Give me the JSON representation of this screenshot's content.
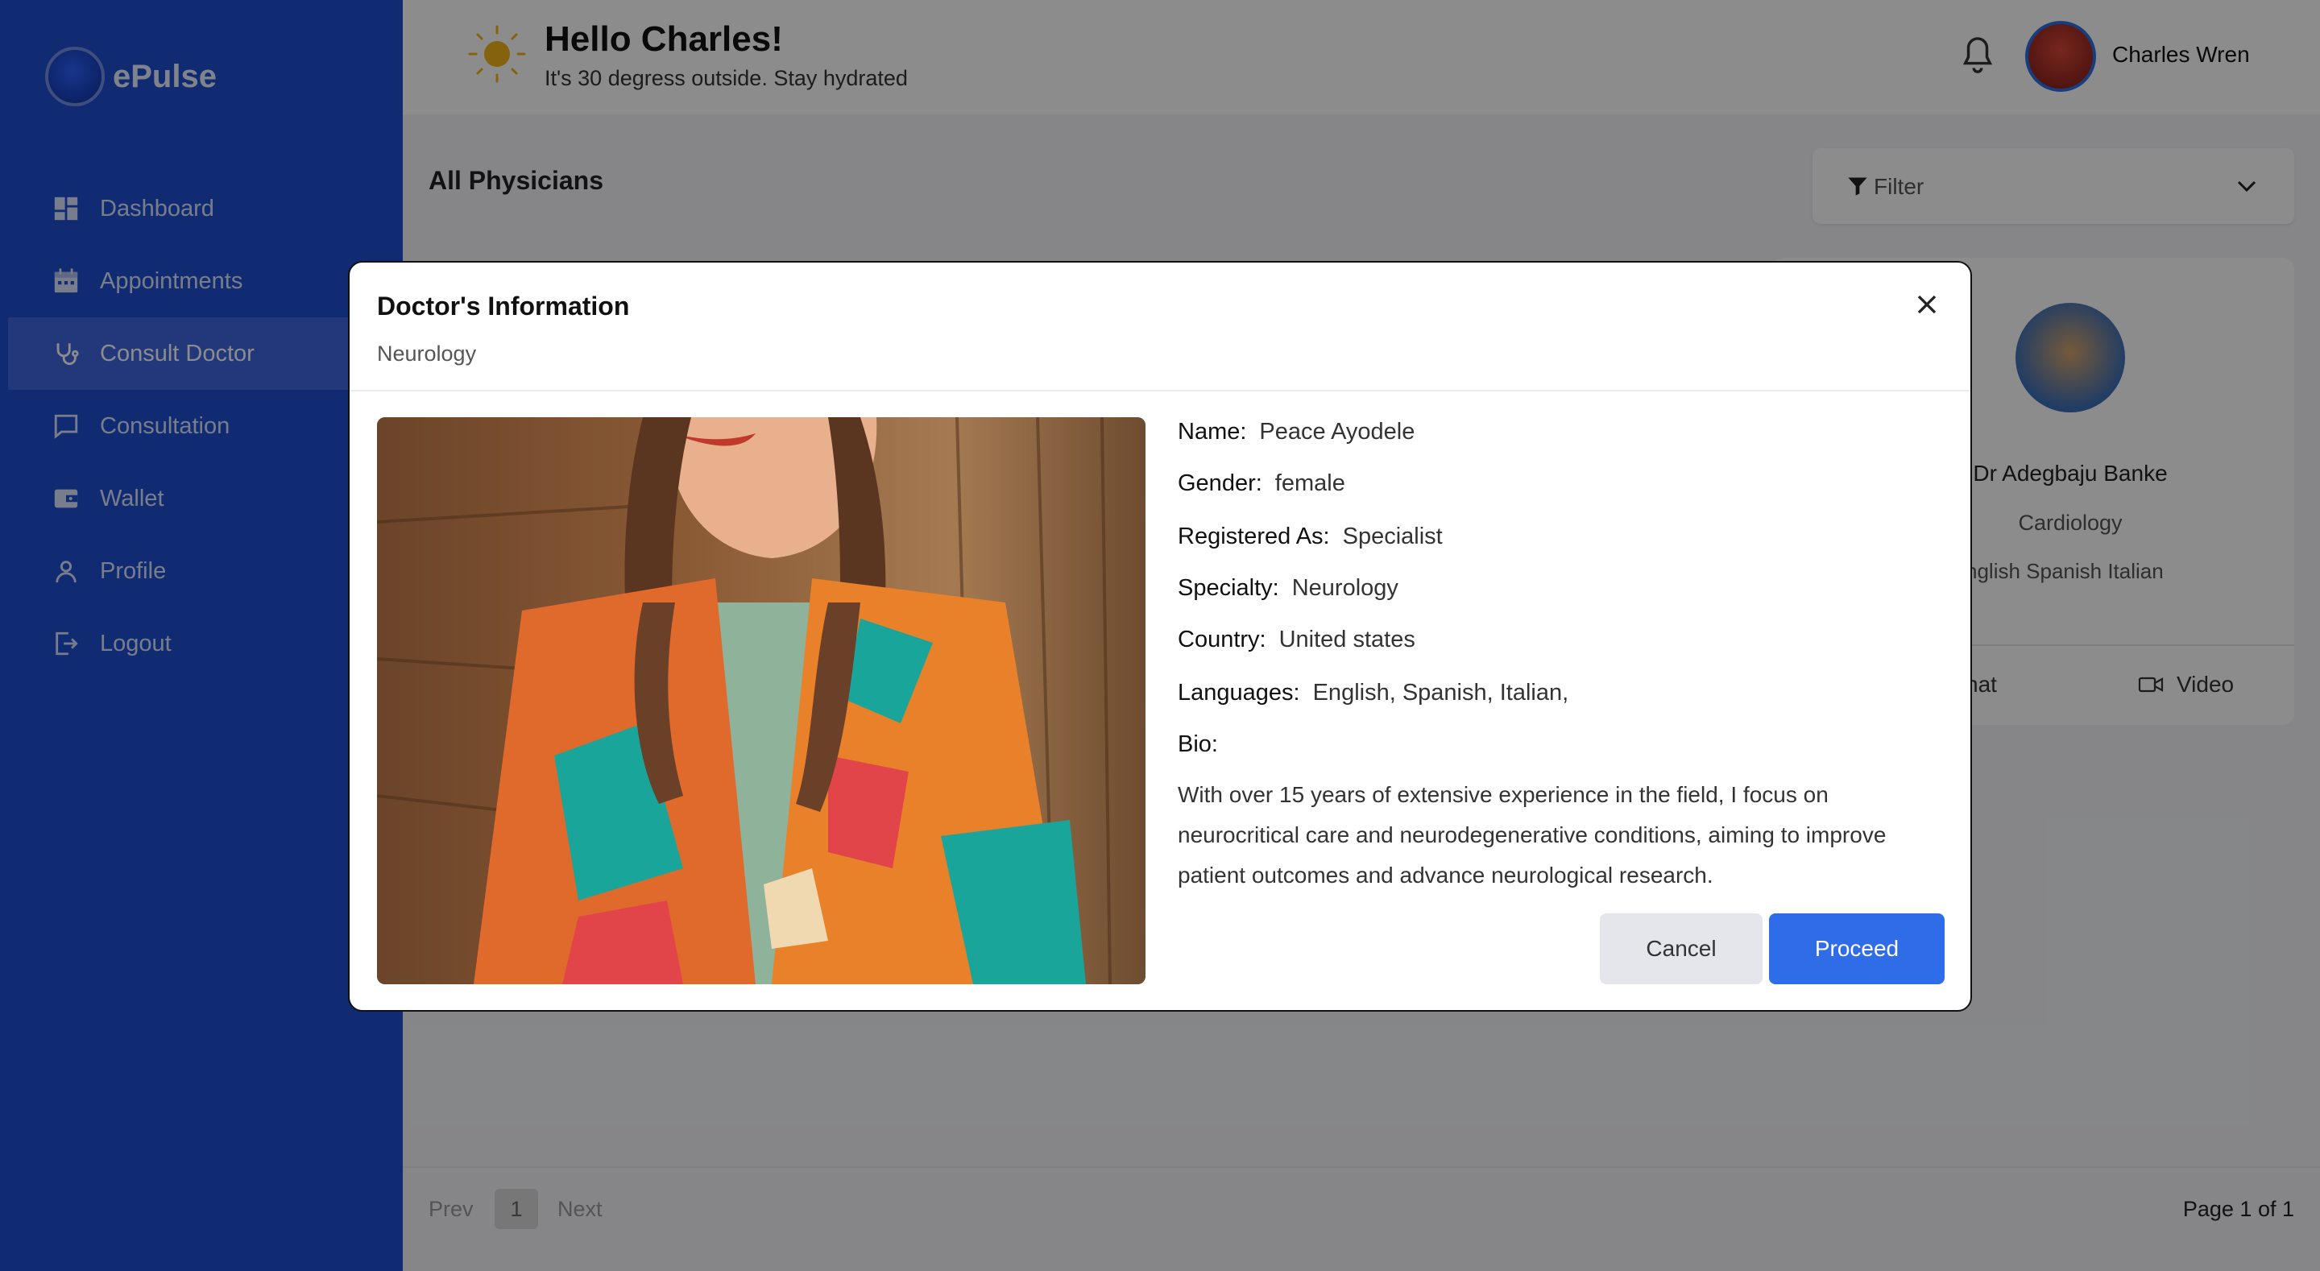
{
  "app": {
    "name": "ePulse"
  },
  "sidebar": {
    "items": [
      {
        "label": "Dashboard",
        "icon": "dashboard-icon"
      },
      {
        "label": "Appointments",
        "icon": "calendar-icon"
      },
      {
        "label": "Consult Doctor",
        "icon": "stethoscope-icon",
        "active": true
      },
      {
        "label": "Consultation",
        "icon": "chat-icon"
      },
      {
        "label": "Wallet",
        "icon": "wallet-icon"
      },
      {
        "label": "Profile",
        "icon": "user-icon"
      },
      {
        "label": "Logout",
        "icon": "logout-icon"
      }
    ]
  },
  "header": {
    "greeting": "Hello Charles!",
    "subtitle": "It's 30 degress outside. Stay hydrated",
    "user_name": "Charles Wren"
  },
  "main": {
    "heading": "All Physicians",
    "filter_label": "Filter"
  },
  "card": {
    "name": "Dr Adegbaju Banke",
    "specialty": "Cardiology",
    "languages": "nglish  Spanish  Italian",
    "chat_label": "hat",
    "video_label": "Video"
  },
  "pagination": {
    "prev": "Prev",
    "current": "1",
    "next": "Next",
    "page_of": "Page 1 of 1"
  },
  "modal": {
    "title": "Doctor's Information",
    "subtitle": "Neurology",
    "fields": {
      "name_label": "Name:",
      "name_value": "Peace Ayodele",
      "gender_label": "Gender:",
      "gender_value": "female",
      "registered_label": "Registered As:",
      "registered_value": "Specialist",
      "specialty_label": "Specialty:",
      "specialty_value": "Neurology",
      "country_label": "Country:",
      "country_value": "United states",
      "languages_label": "Languages:",
      "languages_value": "English,  Spanish,  Italian,",
      "bio_label": "Bio:"
    },
    "bio": "With over 15 years of extensive experience in the field, I focus on neurocritical care and neurodegenerative conditions, aiming to improve patient outcomes and advance neurological research.",
    "cancel_label": "Cancel",
    "proceed_label": "Proceed"
  },
  "colors": {
    "sidebar_bg": "#1f4fd1",
    "accent": "#2f6de8",
    "overlay": "rgba(0,0,0,0.45)"
  }
}
